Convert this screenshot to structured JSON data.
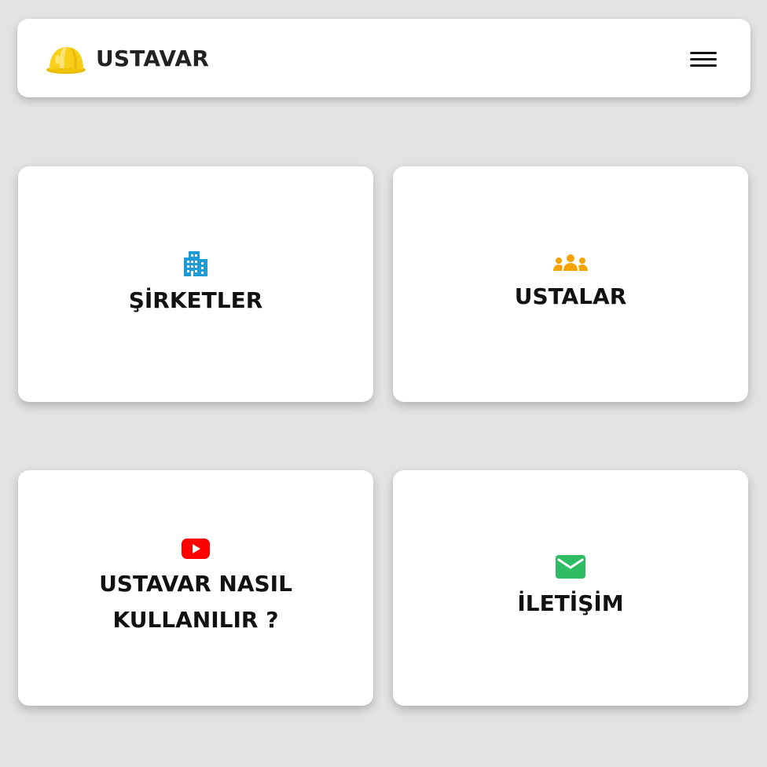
{
  "header": {
    "brand_name": "USTAVAR",
    "logo_icon": "hard-hat-icon",
    "menu_icon": "hamburger-menu-icon"
  },
  "cards": [
    {
      "title": "ŞİRKETLER",
      "icon": "building-icon",
      "icon_color": "#1e9bd7"
    },
    {
      "title": "USTALAR",
      "icon": "users-group-icon",
      "icon_color": "#f5a300"
    },
    {
      "title": "USTAVAR NASIL KULLANILIR ?",
      "icon": "youtube-icon",
      "icon_color": "#ff0000"
    },
    {
      "title": "İLETİŞİM",
      "icon": "envelope-icon",
      "icon_color": "#2ebd63"
    }
  ],
  "colors": {
    "background": "#e3e3e3",
    "surface": "#ffffff",
    "text": "#111111"
  }
}
